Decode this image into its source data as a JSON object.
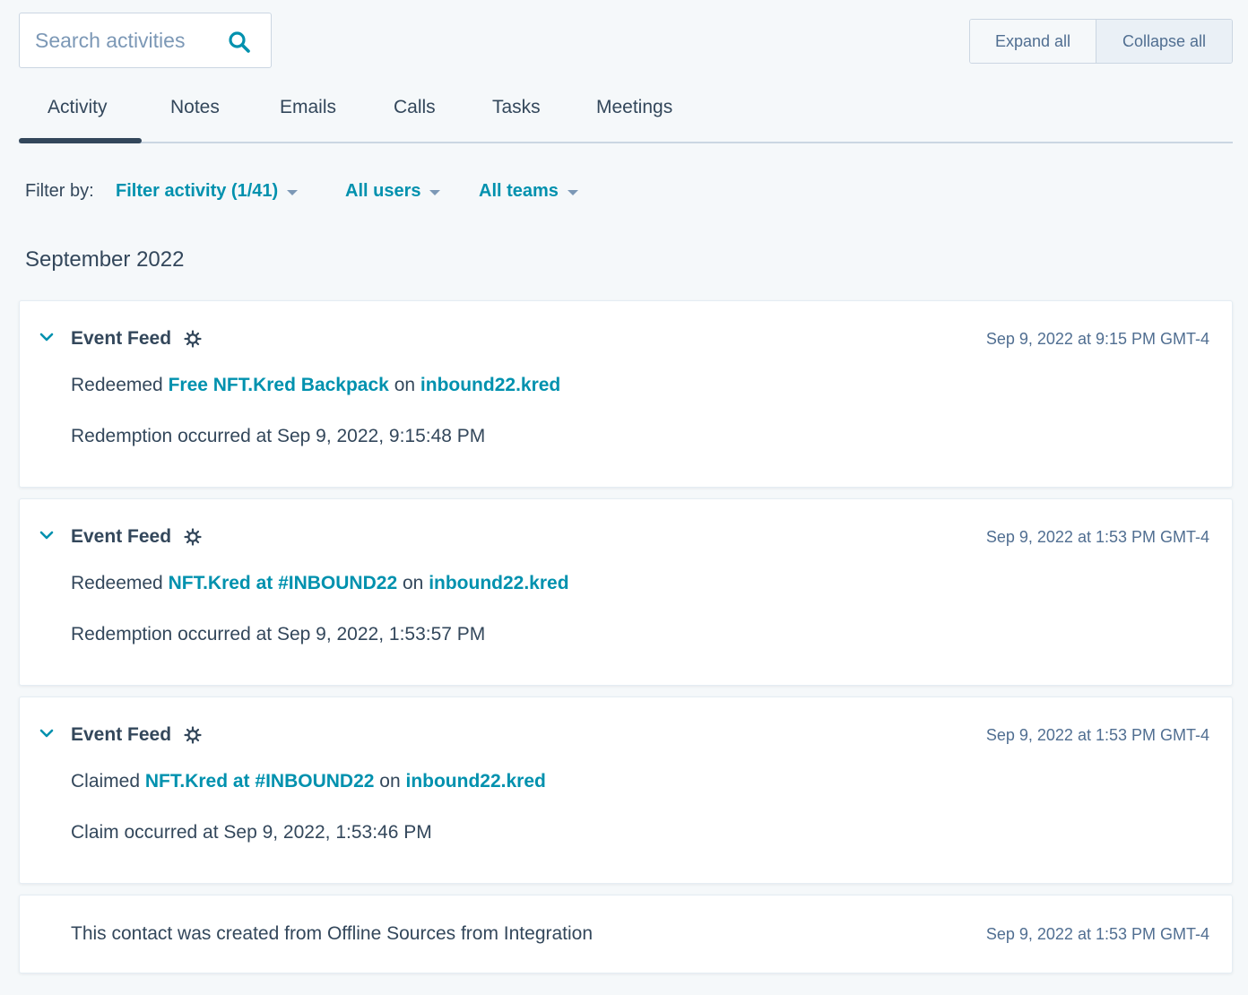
{
  "search": {
    "placeholder": "Search activities"
  },
  "toolbar": {
    "expand_label": "Expand all",
    "collapse_label": "Collapse all"
  },
  "tabs": [
    {
      "label": "Activity",
      "active": true
    },
    {
      "label": "Notes"
    },
    {
      "label": "Emails"
    },
    {
      "label": "Calls"
    },
    {
      "label": "Tasks"
    },
    {
      "label": "Meetings"
    }
  ],
  "filters": {
    "label": "Filter by:",
    "activity": "Filter activity (1/41)",
    "users": "All users",
    "teams": "All teams"
  },
  "month_heading": "September 2022",
  "events": [
    {
      "title": "Event Feed",
      "timestamp": "Sep 9, 2022 at 9:15 PM GMT-4",
      "verb": "Redeemed",
      "item": "Free NFT.Kred Backpack",
      "on": "on",
      "site": "inbound22.kred",
      "detail": "Redemption occurred at Sep 9, 2022, 9:15:48 PM"
    },
    {
      "title": "Event Feed",
      "timestamp": "Sep 9, 2022 at 1:53 PM GMT-4",
      "verb": "Redeemed",
      "item": "NFT.Kred at #INBOUND22",
      "on": "on",
      "site": "inbound22.kred",
      "detail": "Redemption occurred at Sep 9, 2022, 1:53:57 PM"
    },
    {
      "title": "Event Feed",
      "timestamp": "Sep 9, 2022 at 1:53 PM GMT-4",
      "verb": "Claimed",
      "item": "NFT.Kred at #INBOUND22",
      "on": "on",
      "site": "inbound22.kred",
      "detail": "Claim occurred at Sep 9, 2022, 1:53:46 PM"
    }
  ],
  "contact_created": {
    "text": "This contact was created from Offline Sources from Integration",
    "timestamp": "Sep 9, 2022 at 1:53 PM GMT-4"
  },
  "colors": {
    "accent": "#0091ae",
    "text": "#33475b",
    "muted": "#506e91",
    "background": "#f5f8fa"
  },
  "icons": {
    "search": "search-icon",
    "chevron": "chevron-down-icon",
    "gear": "gear-icon",
    "caret": "caret-down-icon"
  }
}
